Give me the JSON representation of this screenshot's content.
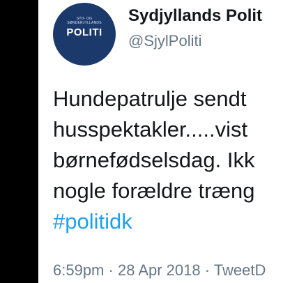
{
  "colors": {
    "background": "#000000",
    "card": "#ffffff",
    "text": "#14171a",
    "muted": "#657786",
    "link": "#1da1f2",
    "avatar": "#1b3a6b"
  },
  "author": {
    "avatar_icon": "police-logo-icon",
    "avatar_top_line1": "SYD- OG",
    "avatar_top_line2": "SØNDERJYLLANDS",
    "avatar_main": "POLITI",
    "name": "Sydjyllands Polit",
    "handle": "@SjylPoliti"
  },
  "tweet": {
    "lines": [
      "Hundepatrulje sendt",
      "husspektakler.....vist",
      "børnefødselsdag. Ikk",
      "nogle forældre træng"
    ],
    "hashtag": "#politidk"
  },
  "meta": {
    "time": "6:59pm",
    "separator": " · ",
    "date": "28 Apr 2018",
    "source": "TweetD"
  }
}
